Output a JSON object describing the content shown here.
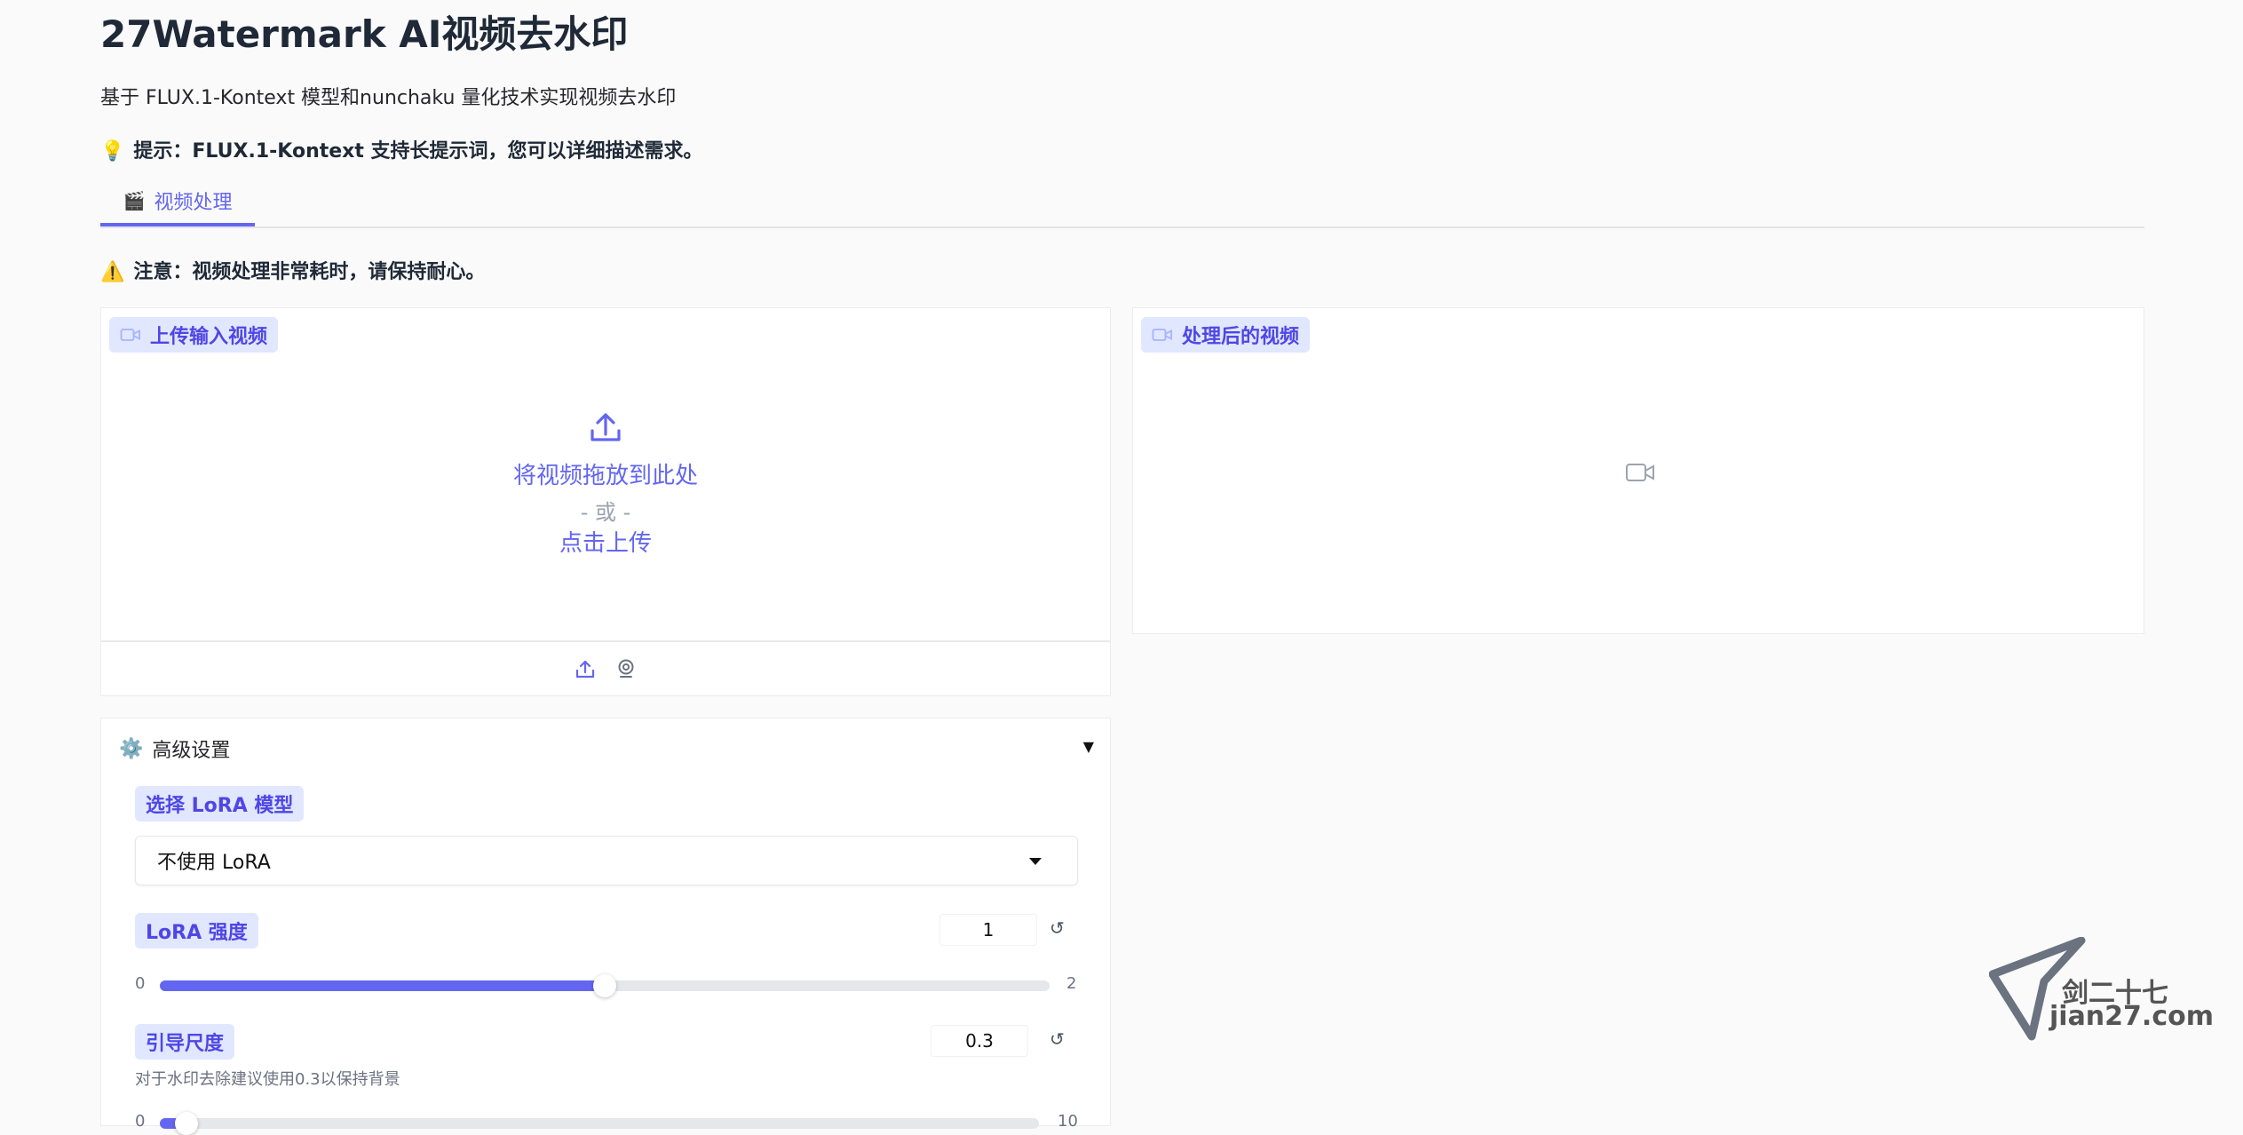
{
  "header": {
    "title": "27Watermark AI视频去水印",
    "subtitle": "基于 FLUX.1-Kontext 模型和nunchaku 量化技术实现视频去水印",
    "tip": "提示：FLUX.1-Kontext 支持长提示词，您可以详细描述需求。"
  },
  "tabs": [
    {
      "label": "视频处理",
      "icon": "clapperboard-icon"
    }
  ],
  "notice": "注意：视频处理非常耗时，请保持耐心。",
  "input_video": {
    "label": "上传输入视频",
    "drop_text": "将视频拖放到此处",
    "or_text": "- 或 -",
    "click_text": "点击上传"
  },
  "output_video": {
    "label": "处理后的视频"
  },
  "advanced": {
    "title": "高级设置",
    "lora_model": {
      "label": "选择 LoRA 模型",
      "selected": "不使用 LoRA"
    },
    "lora_strength": {
      "label": "LoRA 强度",
      "value": "1",
      "min": "0",
      "max": "2",
      "fraction": 0.5
    },
    "guidance": {
      "label": "引导尺度",
      "value": "0.3",
      "info": "对于水印去除建议使用0.3以保持背景",
      "min": "0",
      "max": "10",
      "fraction": 0.03
    }
  },
  "watermark": {
    "line1": "剑二十七",
    "line2": "jian27.com"
  },
  "colors": {
    "accent": "#6366f1",
    "chip_bg": "#e0e7ff"
  }
}
